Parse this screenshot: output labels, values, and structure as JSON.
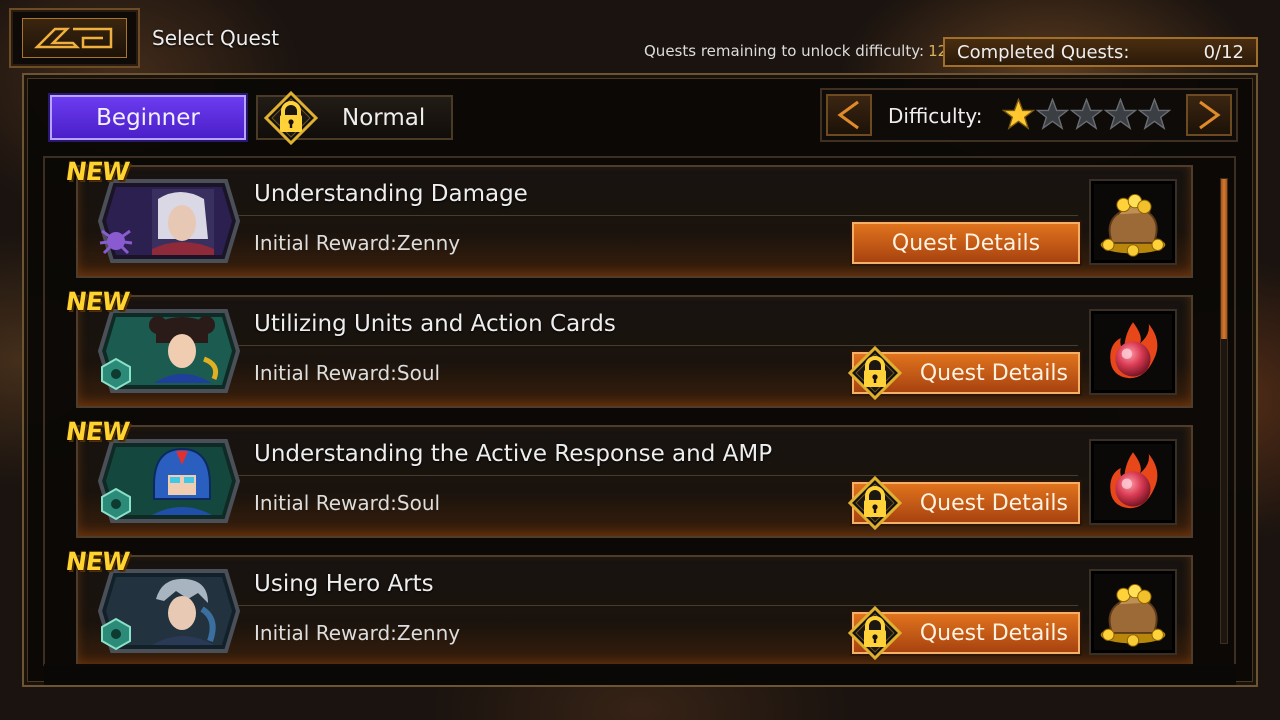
{
  "header": {
    "back_icon": "game-logo-back-icon",
    "title": "Select Quest",
    "unlock_label": "Quests remaining to unlock difficulty:",
    "unlock_count": "12",
    "completed_label": "Completed Quests:",
    "completed_value": "0/12"
  },
  "tabs": [
    {
      "label": "Beginner",
      "selected": true,
      "locked": false
    },
    {
      "label": "Normal",
      "selected": false,
      "locked": true
    }
  ],
  "difficulty": {
    "label": "Difficulty:",
    "filled_stars": 1,
    "total_stars": 5
  },
  "quests": [
    {
      "badge": "NEW",
      "title": "Understanding Damage",
      "reward": "Initial Reward:Zenny",
      "button": "Quest Details",
      "locked": false,
      "reward_icon": "zenny-bag-icon",
      "portrait": "dante-portrait"
    },
    {
      "badge": "NEW",
      "title": "Utilizing Units and Action Cards",
      "reward": "Initial Reward:Soul",
      "button": "Quest Details",
      "locked": true,
      "reward_icon": "soul-orb-icon",
      "portrait": "chun-li-portrait"
    },
    {
      "badge": "NEW",
      "title": "Understanding the Active Response and AMP",
      "reward": "Initial Reward:Soul",
      "button": "Quest Details",
      "locked": true,
      "reward_icon": "soul-orb-icon",
      "portrait": "mega-man-x-portrait"
    },
    {
      "badge": "NEW",
      "title": "Using Hero Arts",
      "reward": "Initial Reward:Zenny",
      "button": "Quest Details",
      "locked": true,
      "reward_icon": "zenny-bag-icon",
      "portrait": "nero-portrait"
    }
  ],
  "colors": {
    "accent_orange": "#d9782c",
    "beginner_purple": "#5a2ee0",
    "new_yellow": "#ffd431",
    "star_gold": "#ffc830"
  }
}
